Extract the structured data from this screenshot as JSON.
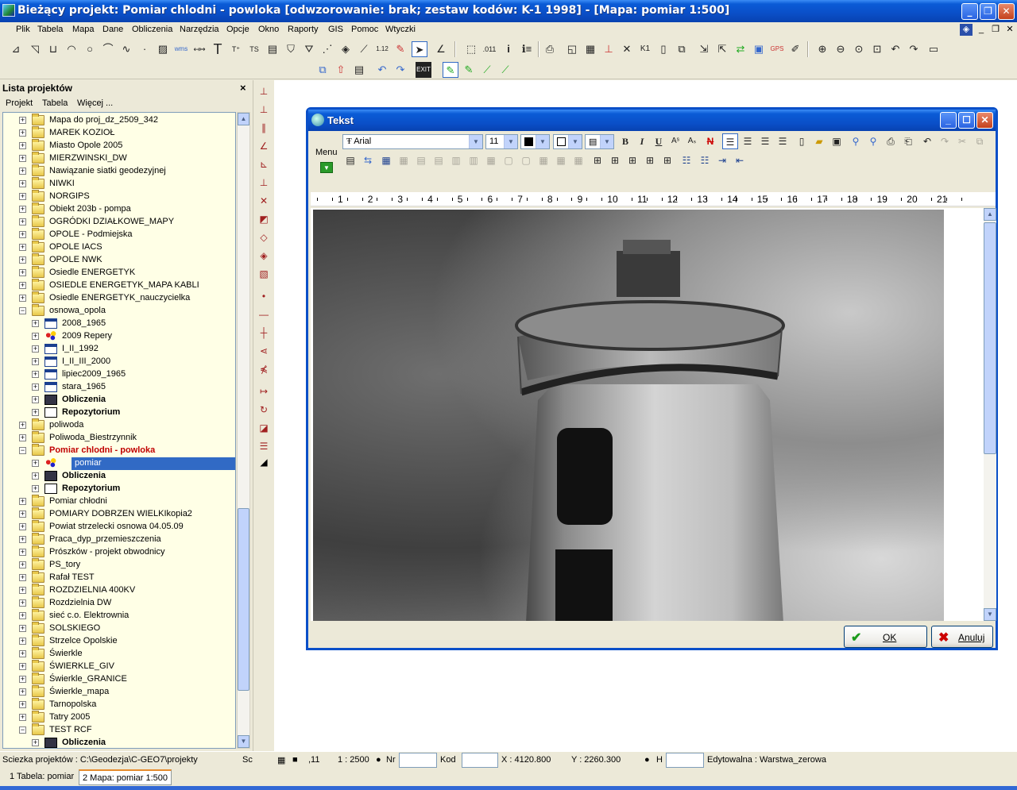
{
  "window": {
    "title": "Bieżący projekt: Pomiar chlodni - powloka [odwzorowanie: brak; zestaw kodów: K-1 1998] - [Mapa: pomiar  1:500]"
  },
  "menu": [
    "Plik",
    "Tabela",
    "Mapa",
    "Dane",
    "Obliczenia",
    "Narzędzia",
    "Opcje",
    "Okno",
    "Raporty",
    "GIS",
    "Pomoc",
    "Wtyczki"
  ],
  "left_panel": {
    "title": "Lista projektów",
    "menu": [
      "Projekt",
      "Tabela",
      "Więcej ..."
    ],
    "tree": [
      {
        "label": "Mapa do proj_dz_2509_342",
        "level": 0,
        "icon": "folder",
        "exp": "+"
      },
      {
        "label": "MAREK KOZIOŁ",
        "level": 0,
        "icon": "folder",
        "exp": "+"
      },
      {
        "label": "Miasto Opole 2005",
        "level": 0,
        "icon": "folder",
        "exp": "+"
      },
      {
        "label": "MIERZWINSKI_DW",
        "level": 0,
        "icon": "folder",
        "exp": "+"
      },
      {
        "label": "Nawiązanie siatki geodezyjnej",
        "level": 0,
        "icon": "folder",
        "exp": "+"
      },
      {
        "label": "NIWKI",
        "level": 0,
        "icon": "folder",
        "exp": "+"
      },
      {
        "label": "NORGIPS",
        "level": 0,
        "icon": "folder",
        "exp": "+"
      },
      {
        "label": "Obiekt 203b - pompa",
        "level": 0,
        "icon": "folder",
        "exp": "+"
      },
      {
        "label": "OGRÓDKI DZIAŁKOWE_MAPY",
        "level": 0,
        "icon": "folder",
        "exp": "+"
      },
      {
        "label": "OPOLE - Podmiejska",
        "level": 0,
        "icon": "folder",
        "exp": "+"
      },
      {
        "label": "OPOLE IACS",
        "level": 0,
        "icon": "folder",
        "exp": "+"
      },
      {
        "label": "OPOLE NWK",
        "level": 0,
        "icon": "folder",
        "exp": "+"
      },
      {
        "label": "Osiedle ENERGETYK",
        "level": 0,
        "icon": "folder",
        "exp": "+"
      },
      {
        "label": "OSIEDLE ENERGETYK_MAPA KABLI",
        "level": 0,
        "icon": "folder",
        "exp": "+"
      },
      {
        "label": "Osiedle ENERGETYK_nauczycielka",
        "level": 0,
        "icon": "folder",
        "exp": "+"
      },
      {
        "label": "osnowa_opola",
        "level": 0,
        "icon": "folder",
        "exp": "−"
      },
      {
        "label": "2008_1965",
        "level": 1,
        "icon": "table",
        "exp": "+"
      },
      {
        "label": "2009 Repery",
        "level": 1,
        "icon": "points",
        "exp": "+"
      },
      {
        "label": "I_II_1992",
        "level": 1,
        "icon": "table",
        "exp": "+"
      },
      {
        "label": "I_II_III_2000",
        "level": 1,
        "icon": "table",
        "exp": "+"
      },
      {
        "label": "lipiec2009_1965",
        "level": 1,
        "icon": "table",
        "exp": "+"
      },
      {
        "label": "stara_1965",
        "level": 1,
        "icon": "table",
        "exp": "+"
      },
      {
        "label": "Obliczenia",
        "level": 1,
        "icon": "calc",
        "exp": "+",
        "style": "bold"
      },
      {
        "label": "Repozytorium",
        "level": 1,
        "icon": "repo",
        "exp": "+",
        "style": "bold"
      },
      {
        "label": "poliwoda",
        "level": 0,
        "icon": "folder",
        "exp": "+"
      },
      {
        "label": "Poliwoda_Biestrzynnik",
        "level": 0,
        "icon": "folder",
        "exp": "+"
      },
      {
        "label": "Pomiar chlodni - powloka",
        "level": 0,
        "icon": "folder",
        "exp": "−",
        "style": "red"
      },
      {
        "label": "pomiar",
        "level": 1,
        "icon": "points",
        "exp": "+",
        "style": "selected"
      },
      {
        "label": "Obliczenia",
        "level": 1,
        "icon": "calc",
        "exp": "+",
        "style": "bold"
      },
      {
        "label": "Repozytorium",
        "level": 1,
        "icon": "repo",
        "exp": "+",
        "style": "bold"
      },
      {
        "label": "Pomiar chłodni",
        "level": 0,
        "icon": "folder",
        "exp": "+"
      },
      {
        "label": "POMIARY DOBRZEN WIELKIkopia2",
        "level": 0,
        "icon": "folder",
        "exp": "+"
      },
      {
        "label": "Powiat strzelecki osnowa 04.05.09",
        "level": 0,
        "icon": "folder",
        "exp": "+"
      },
      {
        "label": "Praca_dyp_przemieszczenia",
        "level": 0,
        "icon": "folder",
        "exp": "+"
      },
      {
        "label": "Prószków - projekt obwodnicy",
        "level": 0,
        "icon": "folder",
        "exp": "+"
      },
      {
        "label": "PS_tory",
        "level": 0,
        "icon": "folder",
        "exp": "+"
      },
      {
        "label": "Rafał TEST",
        "level": 0,
        "icon": "folder",
        "exp": "+"
      },
      {
        "label": "ROZDZIELNIA 400KV",
        "level": 0,
        "icon": "folder",
        "exp": "+"
      },
      {
        "label": "Rozdzielnia DW",
        "level": 0,
        "icon": "folder",
        "exp": "+"
      },
      {
        "label": "sieć c.o. Elektrownia",
        "level": 0,
        "icon": "folder",
        "exp": "+"
      },
      {
        "label": "SOLSKIEGO",
        "level": 0,
        "icon": "folder",
        "exp": "+"
      },
      {
        "label": "Strzelce Opolskie",
        "level": 0,
        "icon": "folder",
        "exp": "+"
      },
      {
        "label": "Świerkle",
        "level": 0,
        "icon": "folder",
        "exp": "+"
      },
      {
        "label": "ŚWIERKLE_GIV",
        "level": 0,
        "icon": "folder",
        "exp": "+"
      },
      {
        "label": "Świerkle_GRANICE",
        "level": 0,
        "icon": "folder",
        "exp": "+"
      },
      {
        "label": "Świerkle_mapa",
        "level": 0,
        "icon": "folder",
        "exp": "+"
      },
      {
        "label": "Tarnopolska",
        "level": 0,
        "icon": "folder",
        "exp": "+"
      },
      {
        "label": "Tatry 2005",
        "level": 0,
        "icon": "folder",
        "exp": "+"
      },
      {
        "label": "TEST RCF",
        "level": 0,
        "icon": "folder",
        "exp": "−"
      },
      {
        "label": "Obliczenia",
        "level": 1,
        "icon": "calc",
        "exp": "+",
        "style": "bold"
      }
    ]
  },
  "dialog": {
    "title": "Tekst",
    "menu_label": "Menu",
    "font": "Arial",
    "font_size": "11",
    "ruler_numbers": [
      "1",
      "2",
      "3",
      "4",
      "5",
      "6",
      "7",
      "8",
      "9",
      "10",
      "11",
      "12",
      "13",
      "14",
      "15",
      "16",
      "17",
      "18",
      "19",
      "20",
      "21"
    ],
    "ok_label": "OK",
    "cancel_label": "Anuluj"
  },
  "status": {
    "path": "Sciezka projektów : C:\\Geodezja\\C-GEO7\\projekty",
    "sc": "Sc",
    "layer_num": ",11",
    "scale": "1 : 2500",
    "nr_label": "Nr",
    "kod_label": "Kod",
    "x": "X : 4120.800",
    "y": "Y : 2260.300",
    "h_label": "H",
    "editable": "Edytowalna : Warstwa_zerowa"
  },
  "tabs": [
    {
      "label": "1 Tabela: pomiar"
    },
    {
      "label": "2 Mapa: pomiar  1:500"
    }
  ]
}
